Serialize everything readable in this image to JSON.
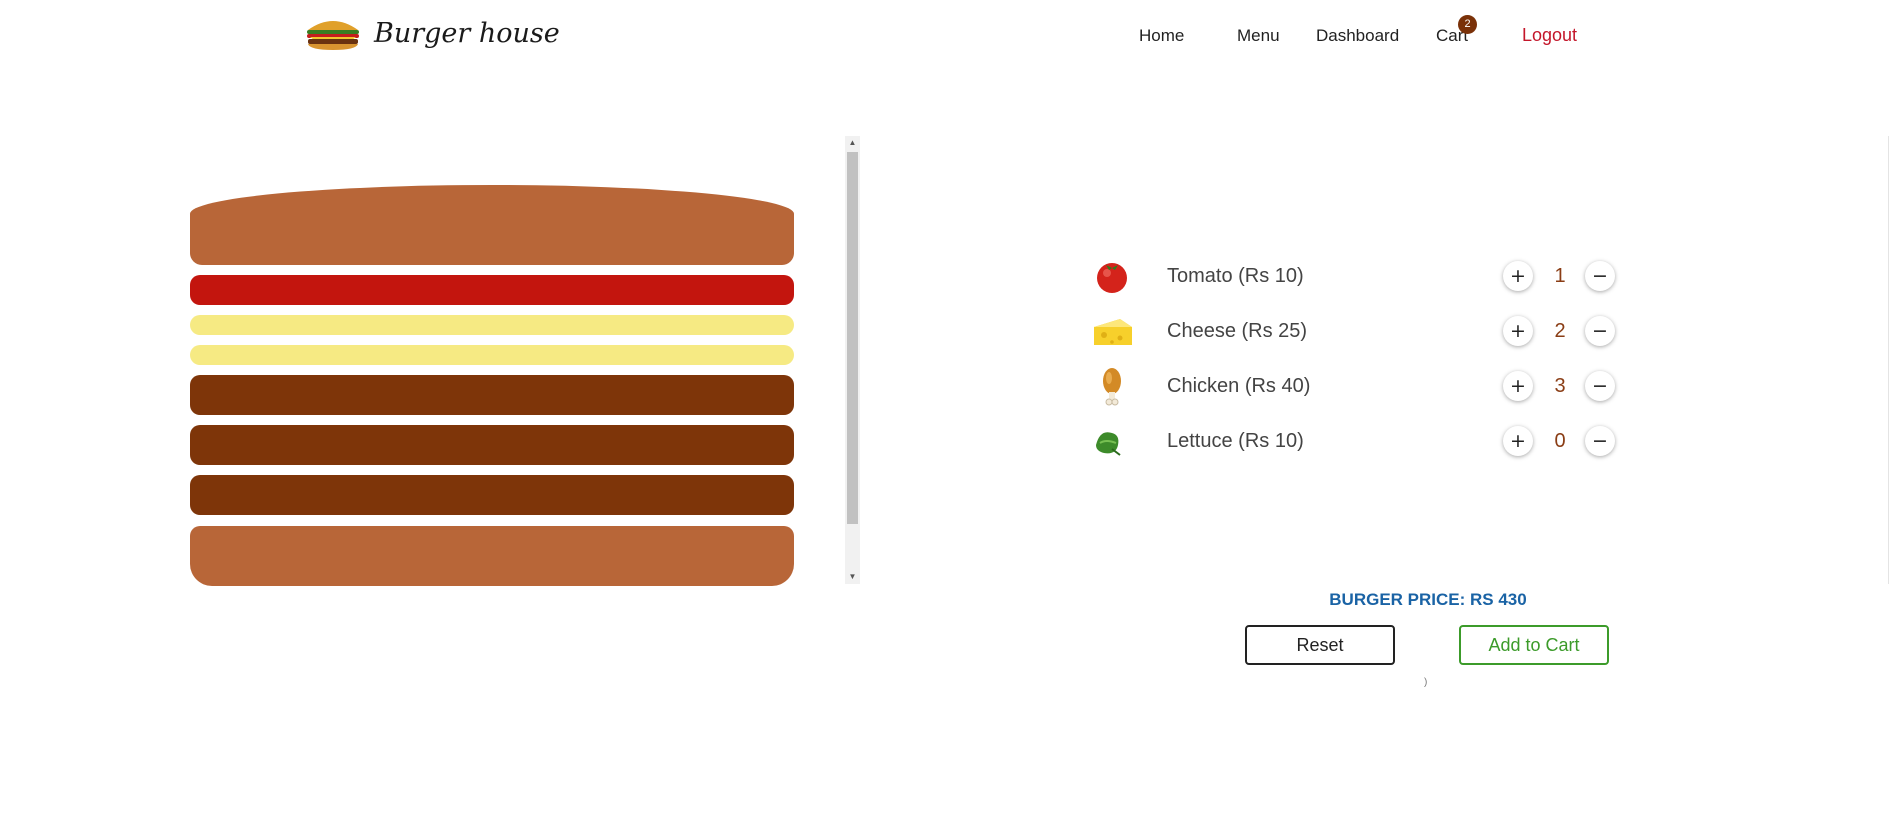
{
  "header": {
    "brand_name": "Burger house",
    "nav": {
      "home": "Home",
      "menu": "Menu",
      "dashboard": "Dashboard",
      "cart": "Cart",
      "cart_count": "2",
      "logout": "Logout"
    }
  },
  "ingredients": [
    {
      "name": "Tomato (Rs 10)",
      "quantity": "1",
      "icon": "tomato-icon"
    },
    {
      "name": "Cheese (Rs 25)",
      "quantity": "2",
      "icon": "cheese-icon"
    },
    {
      "name": "Chicken (Rs 40)",
      "quantity": "3",
      "icon": "chicken-leg-icon"
    },
    {
      "name": "Lettuce (Rs 10)",
      "quantity": "0",
      "icon": "lettuce-icon"
    }
  ],
  "controls": {
    "plus": "+",
    "minus": "−"
  },
  "price_label": "BURGER PRICE: RS 430",
  "actions": {
    "reset": "Reset",
    "add_to_cart": "Add to Cart"
  },
  "colors": {
    "bun": "#b86638",
    "tomato": "#c3150e",
    "cheese": "#f6ea83",
    "meat": "#7e3509",
    "price": "#1a63a5",
    "logout": "#c4162a",
    "add_to_cart": "#3c9b2a"
  }
}
